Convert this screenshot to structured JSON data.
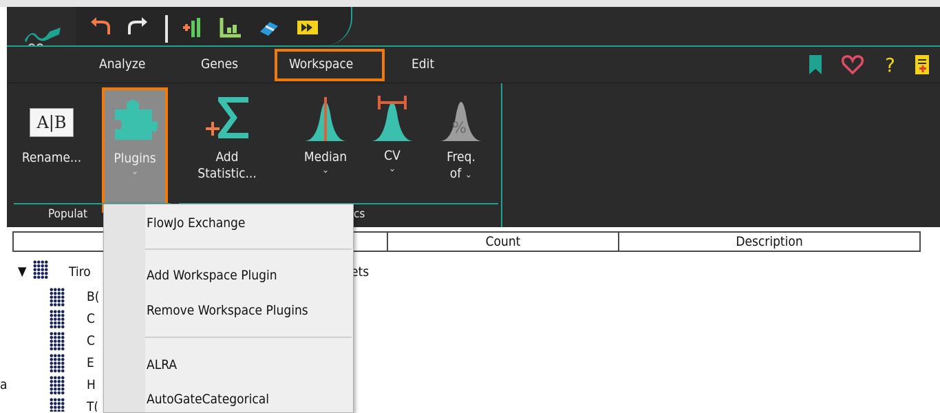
{
  "menu": {
    "items": [
      "Analyze",
      "Genes",
      "Workspace",
      "Edit"
    ],
    "active": "Workspace"
  },
  "ribbon": {
    "rename_label": "Rename...",
    "rename_icon_text": "A|B",
    "plugins_label": "Plugins",
    "add_statistic_label_1": "Add",
    "add_statistic_label_2": "Statistic...",
    "median_label": "Median",
    "cv_label": "CV",
    "freq_label_1": "Freq.",
    "freq_label_2": "of",
    "group_populations_fragment": "Populat",
    "group_statistics_fragment": "cs"
  },
  "table": {
    "columns": [
      "Count",
      "Description"
    ],
    "tree_root_fragment": "Tiro",
    "tree_root_suffix_fragment": "ets",
    "tree_children_fragments": [
      "B(",
      "C",
      "C",
      "E",
      "H",
      "T("
    ]
  },
  "popup_menu": {
    "items": [
      "FlowJo Exchange",
      "Add Workspace Plugin",
      "Remove Workspace Plugins",
      "ALRA",
      "AutoGateCategorical"
    ]
  },
  "misc": {
    "left_edge_fragment": "a"
  },
  "colors": {
    "accent_teal": "#1fa391",
    "highlight_orange": "#f07a0c",
    "toolbar_dark": "#2b2b2b"
  },
  "icons": [
    "undo-icon",
    "redo-icon",
    "add-parameter-icon",
    "layout-icon",
    "eraser-icon",
    "forward-icon",
    "bookmark-icon",
    "heart-icon",
    "help-icon",
    "add-document-icon",
    "puzzle-icon",
    "sigma-icon",
    "median-icon",
    "cv-icon",
    "percent-icon"
  ]
}
